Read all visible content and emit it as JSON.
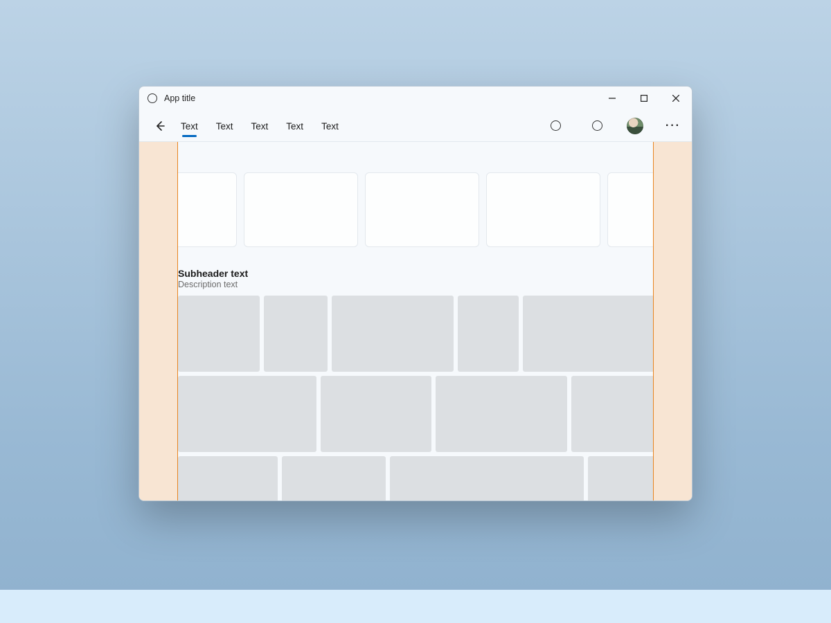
{
  "titlebar": {
    "app_title": "App title"
  },
  "tabs": [
    "Text",
    "Text",
    "Text",
    "Text",
    "Text"
  ],
  "section": {
    "subheader": "Subheader text",
    "description": "Description text"
  },
  "more_glyph": "···",
  "back_arrow": "←"
}
